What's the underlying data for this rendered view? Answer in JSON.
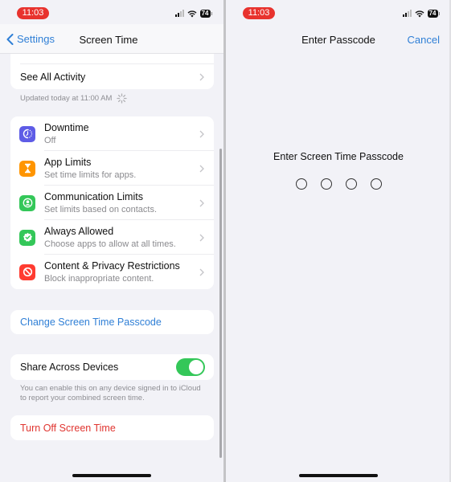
{
  "status_bar": {
    "time": "11:03",
    "battery": "74"
  },
  "left_screen": {
    "nav": {
      "back_label": "Settings",
      "title": "Screen Time"
    },
    "activity": {
      "see_all_label": "See All Activity",
      "updated_text": "Updated today at 11:00 AM"
    },
    "settings_items": [
      {
        "title": "Downtime",
        "subtitle": "Off",
        "icon": "downtime-icon",
        "color": "#5e5ce6"
      },
      {
        "title": "App Limits",
        "subtitle": "Set time limits for apps.",
        "icon": "hourglass-icon",
        "color": "#ff9500"
      },
      {
        "title": "Communication Limits",
        "subtitle": "Set limits based on contacts.",
        "icon": "person-circle-icon",
        "color": "#34c759"
      },
      {
        "title": "Always Allowed",
        "subtitle": "Choose apps to allow at all times.",
        "icon": "checkmark-seal-icon",
        "color": "#34c759"
      },
      {
        "title": "Content & Privacy Restrictions",
        "subtitle": "Block inappropriate content.",
        "icon": "prohibited-icon",
        "color": "#ff3b30"
      }
    ],
    "change_passcode_label": "Change Screen Time Passcode",
    "share_across_devices": {
      "label": "Share Across Devices",
      "enabled": true,
      "footnote_line1": "You can enable this on any device signed in to iCloud",
      "footnote_line2": "to report your combined screen time."
    },
    "turn_off_label": "Turn Off Screen Time"
  },
  "right_screen": {
    "nav": {
      "title": "Enter Passcode",
      "cancel_label": "Cancel"
    },
    "prompt": "Enter Screen Time Passcode",
    "passcode_length": 4,
    "digits_entered": 0
  },
  "colors": {
    "accent_blue": "#2f7fd6",
    "destructive_red": "#e0342f",
    "toggle_green": "#34c759",
    "time_pill_red": "#e8332e"
  }
}
